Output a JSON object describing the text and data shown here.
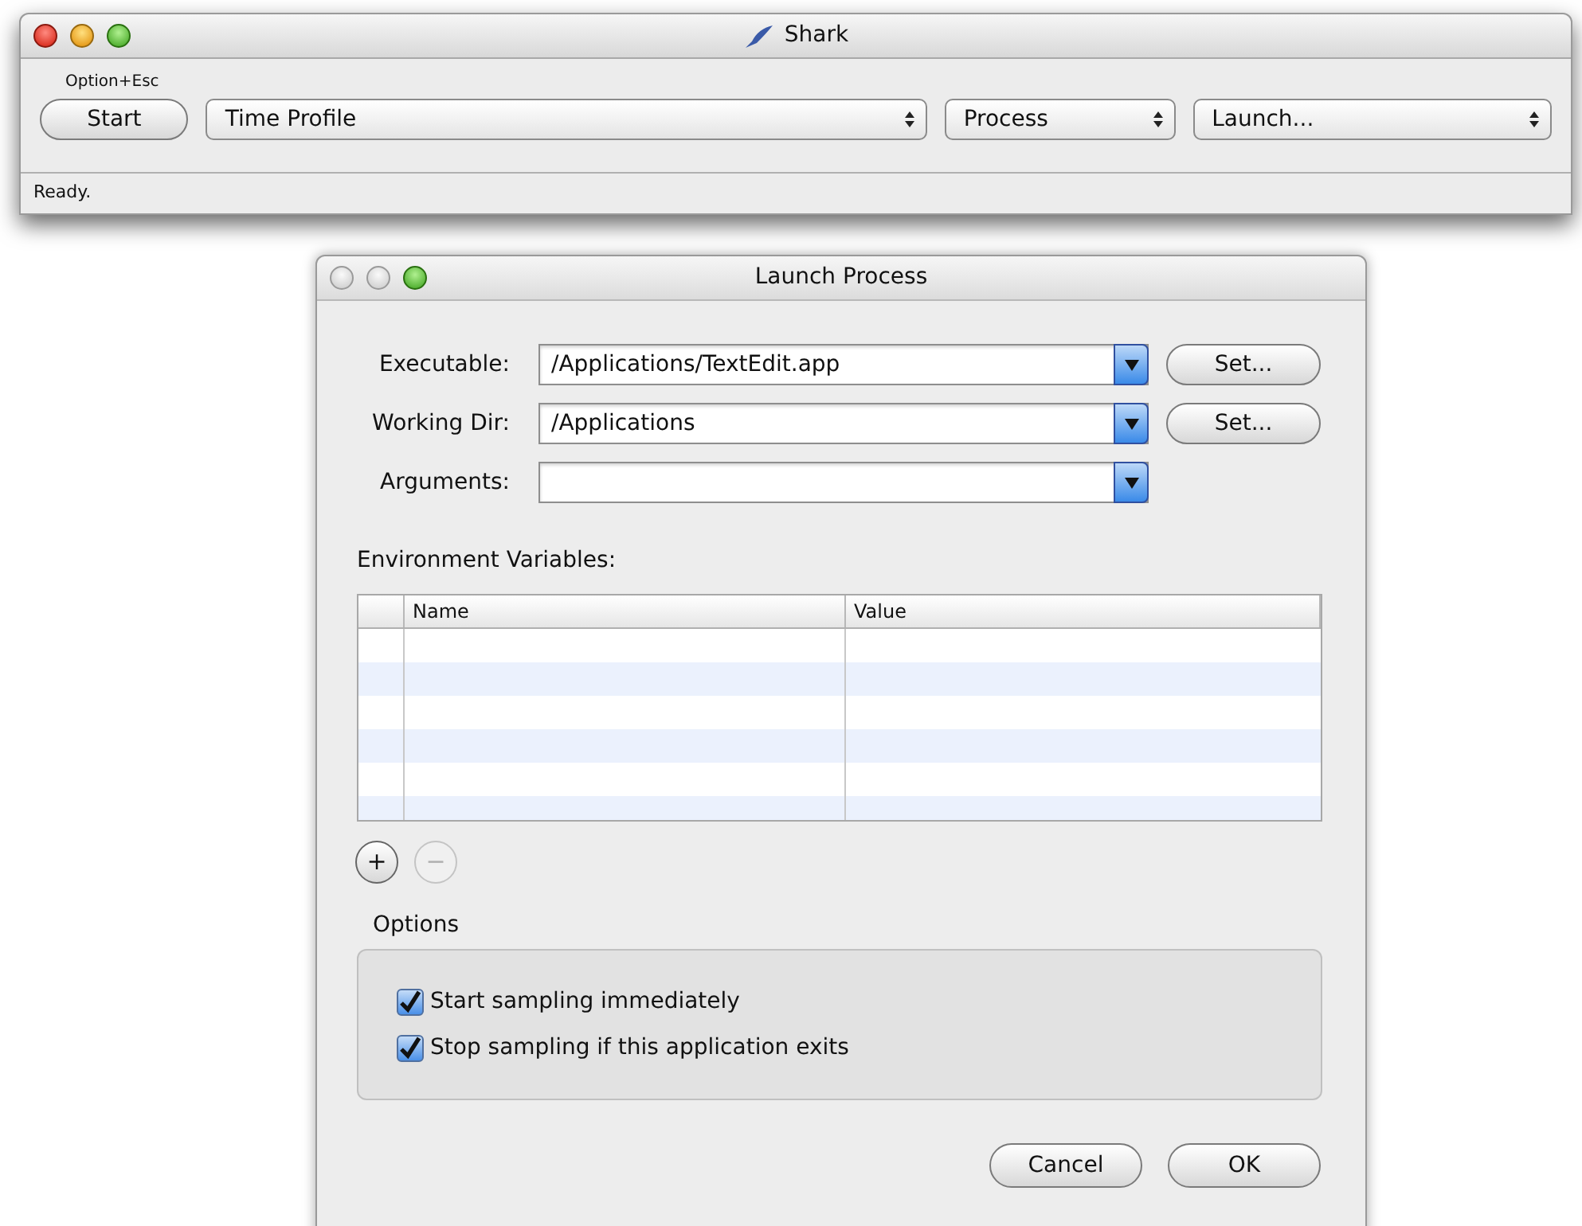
{
  "main_window": {
    "title": "Shark",
    "toolbar": {
      "shortcut_hint": "Option+Esc",
      "start_button": "Start",
      "popups": [
        "Time Profile",
        "Process",
        "Launch..."
      ]
    },
    "status_bar": "Ready."
  },
  "dialog": {
    "title": "Launch Process",
    "fields": [
      {
        "label": "Executable:",
        "value": "/Applications/TextEdit.app",
        "set_button": "Set..."
      },
      {
        "label": "Working Dir:",
        "value": "/Applications",
        "set_button": "Set..."
      },
      {
        "label": "Arguments:"
      }
    ],
    "environment": {
      "title": "Environment Variables:",
      "columns": [
        "Name",
        "Value"
      ],
      "row_buttons": [
        {
          "label": "+",
          "disabled": false
        },
        {
          "label": "−",
          "disabled": true
        }
      ]
    },
    "options": {
      "title": "Options",
      "checkboxes": [
        {
          "label": "Start sampling immediately",
          "checked": true
        },
        {
          "label": "Stop sampling if this application exits",
          "checked": true
        }
      ]
    },
    "buttons": [
      "Cancel",
      "OK"
    ]
  }
}
